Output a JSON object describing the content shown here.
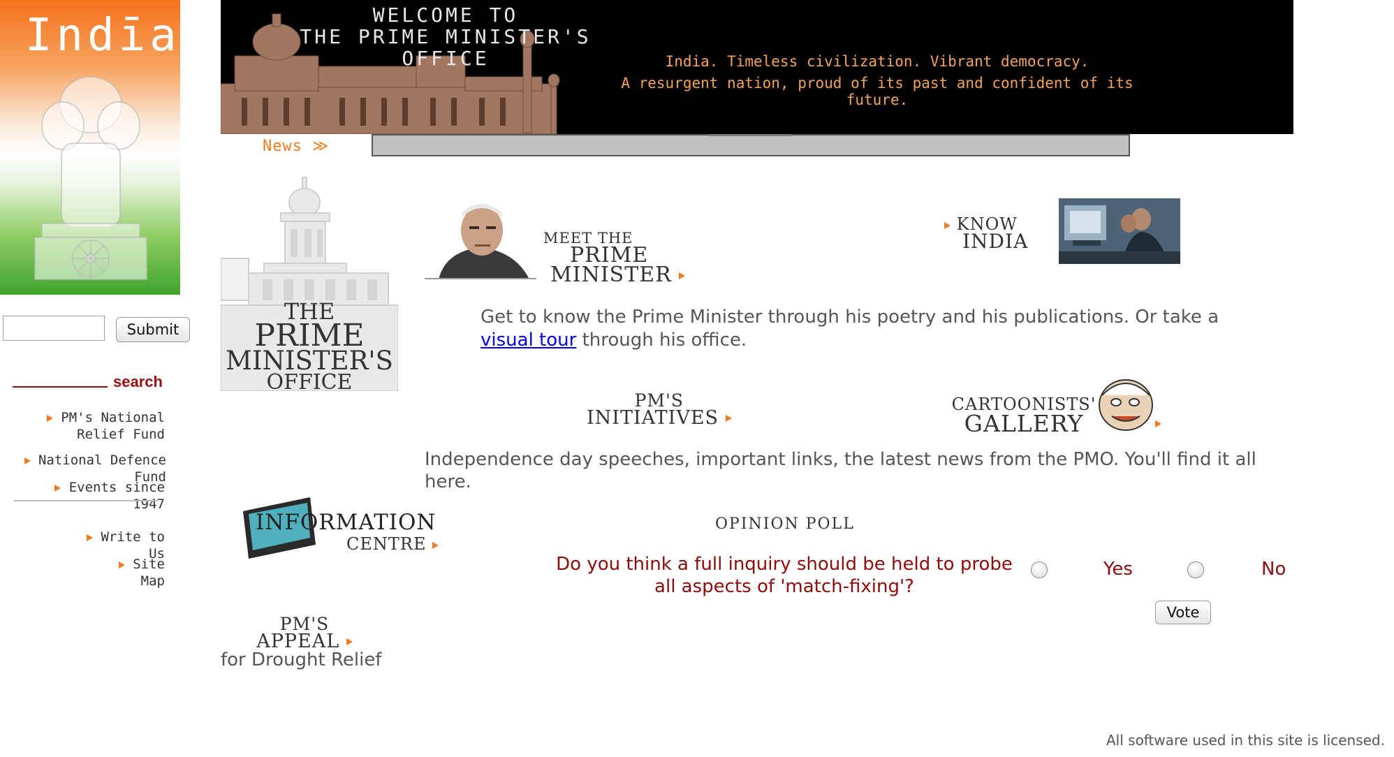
{
  "sidebar": {
    "flag_title": "Indīa",
    "search": {
      "input_value": "",
      "submit_label": "Submit",
      "label": "search"
    },
    "links": [
      {
        "line1": "PM's National",
        "line2": "Relief Fund"
      },
      {
        "line1": "National Defence Fund"
      },
      {
        "line1": "Events since 1947"
      },
      {
        "line1": "Write to Us"
      },
      {
        "line1": "Site Map"
      }
    ]
  },
  "banner": {
    "welcome_line1": "WELCOME TO",
    "welcome_line2": "THE PRIME MINISTER'S",
    "welcome_line3": "OFFICE",
    "tagline1": "India. Timeless civilization. Vibrant democracy.",
    "tagline2": "A resurgent nation, proud of its past and confident of its future."
  },
  "news": {
    "label": "News ≫"
  },
  "pmo_graphic": {
    "line1": "THE",
    "line2": "PRIME",
    "line3": "MINISTER'S",
    "line4": "OFFICE"
  },
  "meet_pm": {
    "line1": "MEET THE",
    "line2": "PRIME",
    "line3": "MINISTER",
    "intro_before": "Get to know the Prime Minister through his poetry and his publications. Or take a ",
    "intro_link": "visual tour",
    "intro_after": " through his office."
  },
  "know_india": {
    "line1": "KNOW",
    "line2": "INDIA"
  },
  "initiatives": {
    "line1": "PM'S",
    "line2": "INITIATIVES"
  },
  "gallery": {
    "line1": "CARTOONISTS'",
    "line2": "GALLERY"
  },
  "mid_text": "Independence day speeches, important links, the latest news from the PMO. You'll find it all here.",
  "info_centre": {
    "line1": "INFORMATION",
    "line2": "CENTRE"
  },
  "poll": {
    "title": "OPINION POLL",
    "question": "Do you think a full inquiry should be held to probe all aspects of 'match-fixing'?",
    "yes_label": "Yes",
    "no_label": "No",
    "vote_label": "Vote"
  },
  "appeal": {
    "line1": "PM'S",
    "line2": "APPEAL",
    "sub": "for Drought Relief"
  },
  "footer": "All software used in this site is licensed."
}
